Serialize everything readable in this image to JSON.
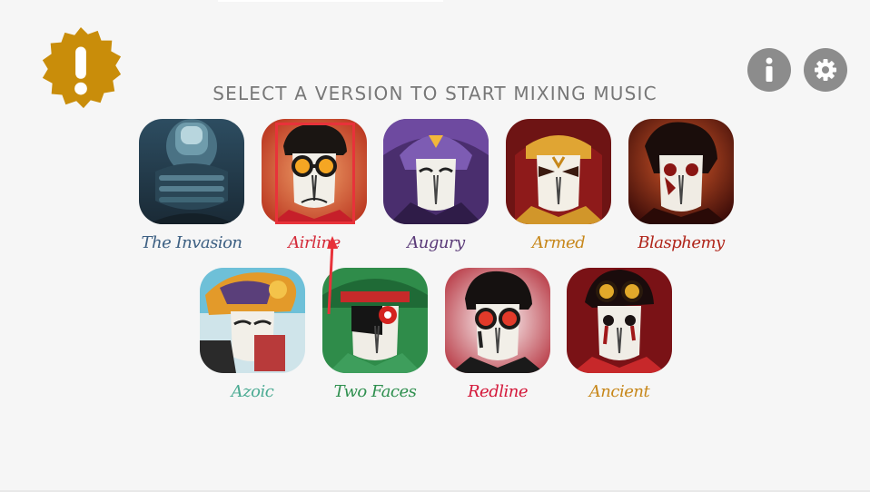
{
  "header": {
    "title": "SELECT A VERSION TO START MIXING MUSIC"
  },
  "icons": {
    "alert": "exclamation-badge-icon",
    "info": "info-icon",
    "settings": "gear-icon"
  },
  "colors": {
    "background": "#f6f6f6",
    "alert_badge": "#c98d0a",
    "round_button": "#8c8c8c",
    "highlight": "#e8323a"
  },
  "versions": [
    {
      "label": "The Invasion",
      "color": "#3d6083"
    },
    {
      "label": "Airline",
      "color": "#d42b3a",
      "highlighted": true
    },
    {
      "label": "Augury",
      "color": "#5a3a78"
    },
    {
      "label": "Armed",
      "color": "#c7871a"
    },
    {
      "label": "Blasphemy",
      "color": "#b02419"
    },
    {
      "label": "Azoic",
      "color": "#4bab93"
    },
    {
      "label": "Two Faces",
      "color": "#2e8f4e"
    },
    {
      "label": "Redline",
      "color": "#d4183a"
    },
    {
      "label": "Ancient",
      "color": "#c7871a"
    }
  ]
}
